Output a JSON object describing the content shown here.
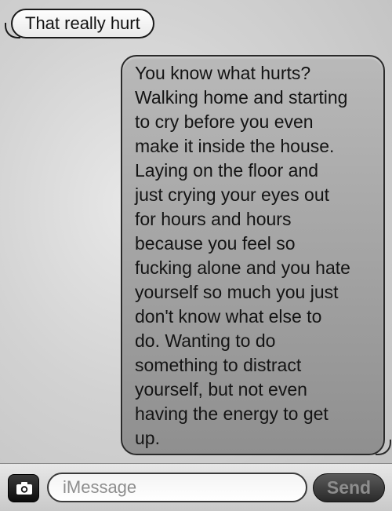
{
  "thread": {
    "messages": [
      {
        "direction": "incoming",
        "text": "That really hurt"
      },
      {
        "direction": "outgoing",
        "text": "You know what hurts?\nWalking home and starting\nto cry before you even\nmake it inside the house.\nLaying on the floor and\njust crying your eyes out\nfor hours and hours\nbecause you feel so\nfucking alone and you hate\nyourself so much you just\ndon't know what else to\ndo. Wanting to do\nsomething to distract\nyourself, but not even\nhaving the energy to get\nup."
      }
    ]
  },
  "input_bar": {
    "camera_icon": "camera-icon",
    "placeholder": "iMessage",
    "value": "",
    "send_label": "Send"
  },
  "colors": {
    "background": "#d2d2d2",
    "incoming_bubble": "#f2f2f2",
    "outgoing_bubble": "#a5a5a5",
    "send_button": "#3a3a3a"
  }
}
